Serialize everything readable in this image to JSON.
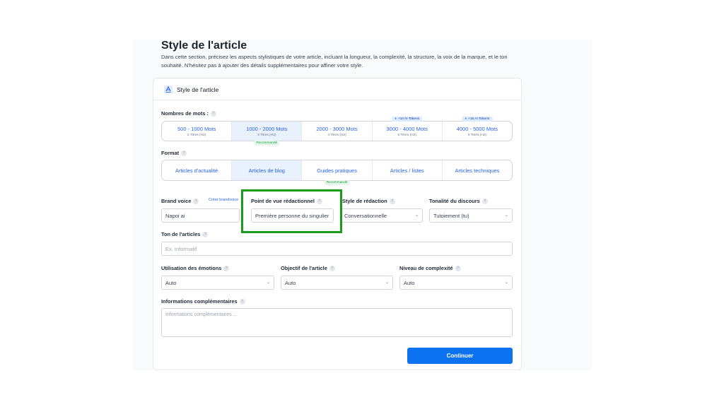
{
  "page": {
    "title": "Style de l'article",
    "description": "Dans cette section, précisez les aspects stylistiques de votre article, incluant la longueur, la complexité, la structure, la voix de la marque, et le ton souhaité. N'hésitez pas à ajouter des détails supplémentaires pour affiner votre style."
  },
  "card": {
    "title": "Style de l'article"
  },
  "info_glyph": "?",
  "word_count": {
    "label": "Nombres de mots :",
    "options": [
      {
        "label": "500 - 1000 Mots",
        "sub": "2 Titres (H2)"
      },
      {
        "label": "1000 - 2000 Mots",
        "sub": "3 Titres (H2)",
        "badge": "Recommandé"
      },
      {
        "label": "2000 - 3000 Mots",
        "sub": "4 Titres (H2)"
      },
      {
        "label": "3000 - 4000 Mots",
        "sub": "5 Titres (H2)",
        "token": "+10 AI Tokens"
      },
      {
        "label": "4000 - 5000 Mots",
        "sub": "6 Titres (H2)",
        "token": "+15 AI Tokens"
      }
    ],
    "selected": "1000 - 2000 Mots"
  },
  "format": {
    "label": "Format",
    "options": [
      {
        "label": "Articles d'actualité"
      },
      {
        "label": "Articles de blog"
      },
      {
        "label": "Guides pratiques",
        "badge": "Recommandé"
      },
      {
        "label": "Articles / listes"
      },
      {
        "label": "Articles techniques"
      }
    ],
    "selected": "Articles de blog"
  },
  "brand_voice": {
    "label": "Brand voice",
    "link": "Créer brandvoice",
    "value": "Napoi ai"
  },
  "point_of_view": {
    "label": "Point de vue rédactionnel",
    "value": "Première personne du singulier"
  },
  "writing_style": {
    "label": "Style de rédaction",
    "value": "Conversationnelle"
  },
  "tone_discourse": {
    "label": "Tonalité du discours",
    "value": "Tutoiement (tu)"
  },
  "article_tone": {
    "label": "Ton de l'articles",
    "placeholder": "Ex. Informatif"
  },
  "emotions": {
    "label": "Utilisation des émotions",
    "value": "Auto"
  },
  "objective": {
    "label": "Objectif de l'article",
    "value": "Auto"
  },
  "complexity": {
    "label": "Niveau de complexité",
    "value": "Auto"
  },
  "additional_info": {
    "label": "Informations complémentaires",
    "placeholder": "Informations complémentaires ..."
  },
  "continue_button": "Continuer",
  "colors": {
    "accent": "#0d72ef",
    "highlight": "#1a9b1a",
    "selected_bg": "#e8f1fc"
  }
}
